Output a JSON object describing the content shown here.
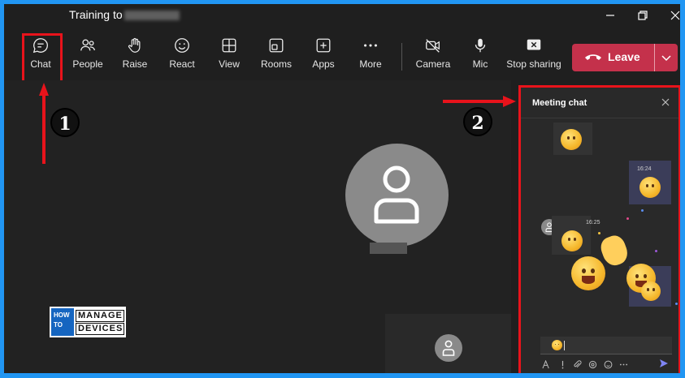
{
  "window": {
    "title": "Training to"
  },
  "toolbar": {
    "buttons": [
      {
        "id": "chat",
        "label": "Chat",
        "icon": "chat-icon"
      },
      {
        "id": "people",
        "label": "People",
        "icon": "people-icon"
      },
      {
        "id": "raise",
        "label": "Raise",
        "icon": "raise-hand-icon"
      },
      {
        "id": "react",
        "label": "React",
        "icon": "smiley-icon"
      },
      {
        "id": "view",
        "label": "View",
        "icon": "grid-icon"
      },
      {
        "id": "rooms",
        "label": "Rooms",
        "icon": "rooms-icon"
      },
      {
        "id": "apps",
        "label": "Apps",
        "icon": "add-app-icon"
      },
      {
        "id": "more",
        "label": "More",
        "icon": "more-icon"
      },
      {
        "id": "camera",
        "label": "Camera",
        "icon": "camera-off-icon"
      },
      {
        "id": "mic",
        "label": "Mic",
        "icon": "mic-icon"
      },
      {
        "id": "stop-sharing",
        "label": "Stop sharing",
        "icon": "stop-share-icon"
      }
    ],
    "leave_label": "Leave"
  },
  "chat": {
    "title": "Meeting chat",
    "messages": [
      {
        "time": "16:24"
      },
      {
        "time": "16:25"
      }
    ]
  },
  "annotations": {
    "badge1": "1",
    "badge2": "2"
  },
  "logo": {
    "left_line1": "HOW",
    "left_line2": "TO",
    "right_line1": "MANAGE",
    "right_line2": "DEVICES"
  },
  "colors": {
    "accent_red": "#e8131b",
    "leave": "#c4314b",
    "frame": "#2196f3"
  }
}
